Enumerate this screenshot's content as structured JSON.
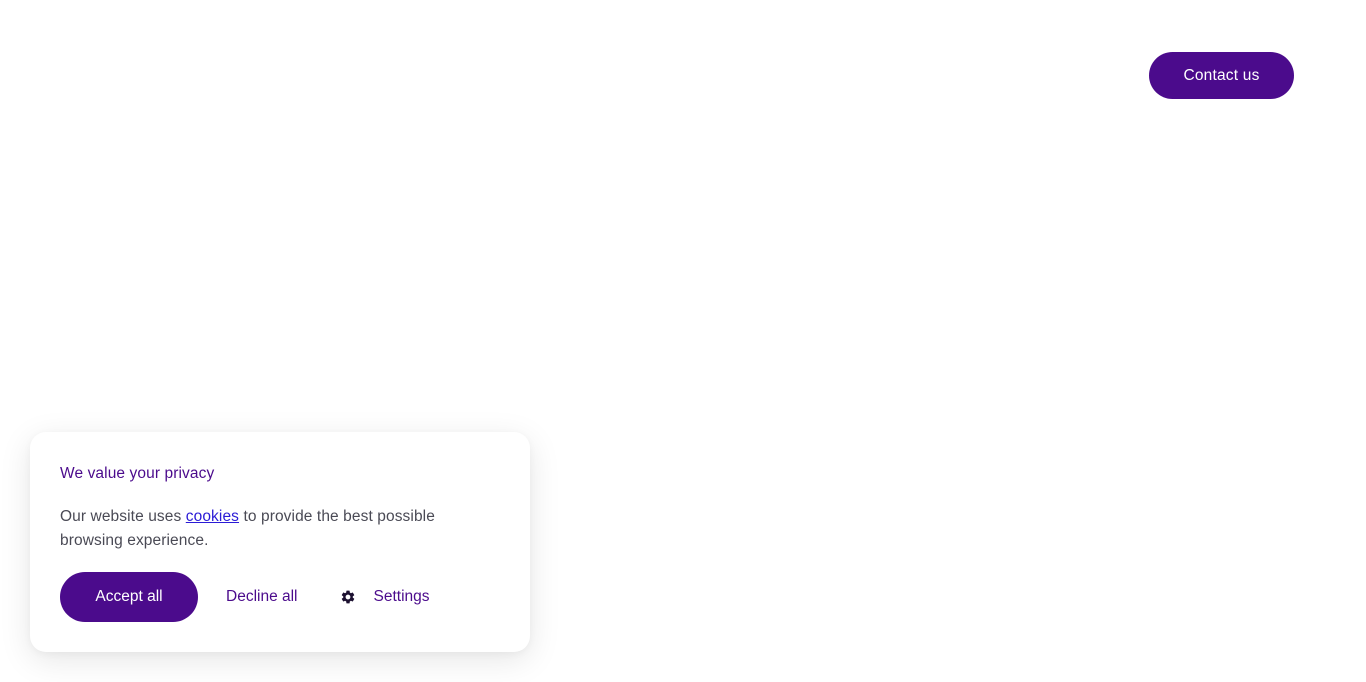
{
  "header": {
    "contact_label": "Contact us"
  },
  "cookie_banner": {
    "title": "We value your privacy",
    "body_prefix": "Our website uses ",
    "body_link": "cookies",
    "body_suffix": " to provide the best possible browsing experience.",
    "accept_label": "Accept all",
    "decline_label": "Decline all",
    "settings_label": "Settings",
    "settings_icon": "gear-icon"
  },
  "colors": {
    "brand": "#4b0b8c",
    "link": "#2b1bd6",
    "body_text": "#4a4a55",
    "background": "#ffffff"
  }
}
